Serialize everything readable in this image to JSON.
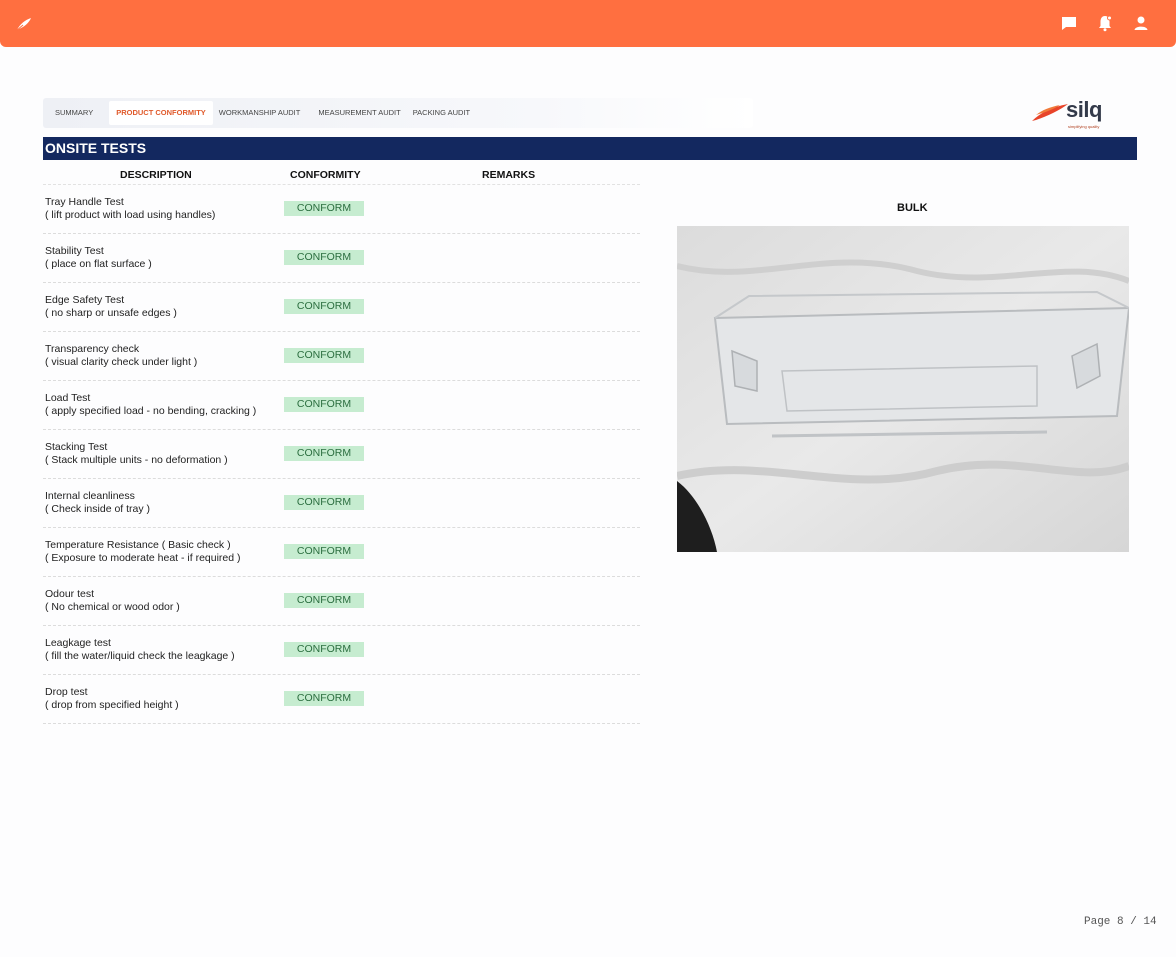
{
  "tabs": [
    "SUMMARY",
    "PRODUCT CONFORMITY",
    "WORKMANSHIP AUDIT",
    "MEASUREMENT AUDIT",
    "PACKING AUDIT"
  ],
  "active_tab": "PRODUCT CONFORMITY",
  "brand": {
    "word": "silq",
    "tagline": "simplifying quality"
  },
  "section_title": "ONSITE TESTS",
  "table": {
    "headers": {
      "description": "DESCRIPTION",
      "conformity": "CONFORMITY",
      "remarks": "REMARKS"
    },
    "rows": [
      {
        "name": "Tray Handle Test",
        "detail": "( lift product with load using handles)",
        "status": "CONFORM",
        "remarks": ""
      },
      {
        "name": "Stability Test",
        "detail": "(  place on flat surface )",
        "status": "CONFORM",
        "remarks": ""
      },
      {
        "name": "Edge Safety Test",
        "detail": "( no sharp or unsafe edges )",
        "status": "CONFORM",
        "remarks": ""
      },
      {
        "name": "Transparency check",
        "detail": "( visual clarity check under light )",
        "status": "CONFORM",
        "remarks": ""
      },
      {
        "name": "Load Test",
        "detail": "( apply specified load - no bending, cracking )",
        "status": "CONFORM",
        "remarks": ""
      },
      {
        "name": "Stacking Test",
        "detail": "( Stack multiple units - no deformation )",
        "status": "CONFORM",
        "remarks": ""
      },
      {
        "name": "Internal cleanliness",
        "detail": "( Check inside of tray )",
        "status": "CONFORM",
        "remarks": ""
      },
      {
        "name": "Temperature Resistance ( Basic check )",
        "detail": "( Exposure to moderate heat - if required )",
        "status": "CONFORM",
        "remarks": ""
      },
      {
        "name": "Odour test",
        "detail": "( No chemical or wood odor )",
        "status": "CONFORM",
        "remarks": ""
      },
      {
        "name": "Leagkage test",
        "detail": "( fill the water/liquid check the leagkage )",
        "status": "CONFORM",
        "remarks": ""
      },
      {
        "name": "Drop test",
        "detail": "( drop from specified height )",
        "status": "CONFORM",
        "remarks": ""
      }
    ]
  },
  "photo_title": "BULK",
  "page_number": "Page 8 / 14",
  "colors": {
    "topbar": "#ff6f40",
    "banner": "#13285f",
    "active_tab": "#e05a2b",
    "badge_bg": "#c6ecd0",
    "badge_text": "#2b6e3f"
  },
  "icons": {
    "app_logo": "feather-icon",
    "chat": "chat-icon",
    "notifications": "bell-icon",
    "profile": "user-icon"
  }
}
